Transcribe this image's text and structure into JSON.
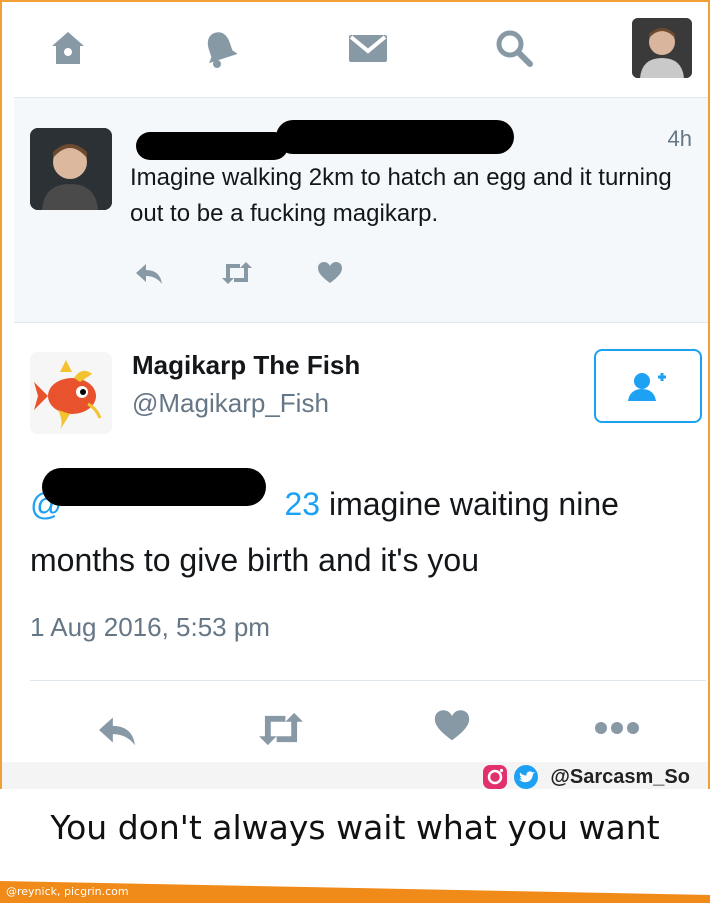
{
  "colors": {
    "twitter_blue": "#1da1f2",
    "icon_gray": "#657786",
    "text_dark": "#14171a",
    "border_orange": "#f0a035",
    "footer_orange": "#f08a18"
  },
  "navbar": {
    "icons": [
      "home-icon",
      "notifications-bell-icon",
      "messages-envelope-icon",
      "search-icon",
      "profile-avatar"
    ]
  },
  "tweet1": {
    "time": "4h",
    "text": "Imagine walking 2km to hatch an egg and it turning out to be a fucking magikarp.",
    "actions": [
      "reply-icon",
      "retweet-icon",
      "like-heart-icon"
    ]
  },
  "tweet2": {
    "name": "Magikarp The Fish",
    "handle": "@Magikarp_Fish",
    "mention_visible_start": "@",
    "mention_visible_end": "23",
    "text": " imagine waiting nine months to give birth and it's you",
    "date": "1 Aug 2016, 5:53 pm",
    "actions": [
      "reply-icon",
      "retweet-icon",
      "like-heart-icon",
      "more-dots-icon"
    ]
  },
  "watermark": {
    "handle": "@Sarcasm_So",
    "icons": [
      "instagram-icon",
      "twitter-bird-icon"
    ]
  },
  "caption": "You don't always wait what you want",
  "footer_credit": "@reynick, picgrin.com"
}
